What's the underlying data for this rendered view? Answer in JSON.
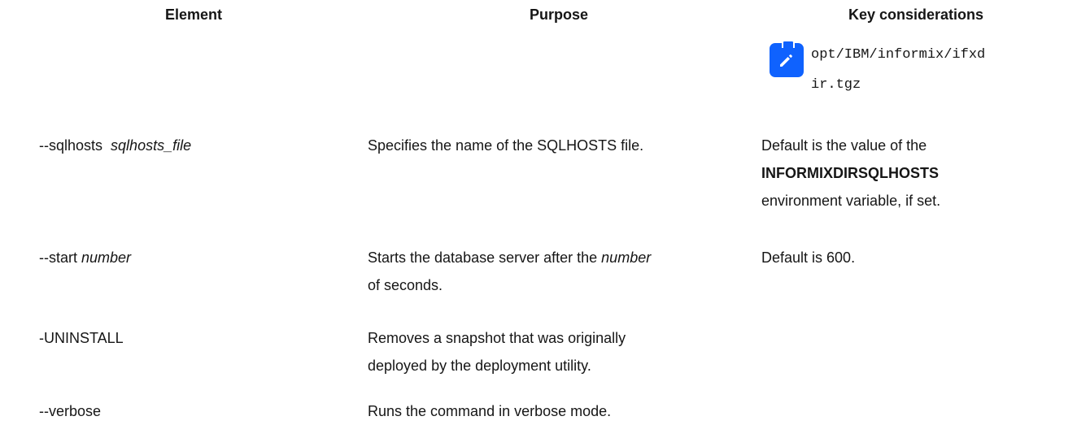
{
  "headers": {
    "element": "Element",
    "purpose": "Purpose",
    "key": "Key considerations"
  },
  "note": {
    "icon": "edit-note-icon",
    "path_line1": "opt/IBM/informix/ifxd",
    "path_line2": "ir.tgz"
  },
  "rows": [
    {
      "element_prefix": "--sqlhosts",
      "element_arg": "sqlhosts_file",
      "purpose_line1": "Specifies the name of the SQLHOSTS file.",
      "key_line1": "Default is the value of the",
      "key_bold": "INFORMIXDIRSQLHOSTS",
      "key_line3": "environment variable, if set."
    },
    {
      "element_prefix": "--start",
      "element_arg": "number",
      "purpose_line1_pre": "Starts the database server after the",
      "purpose_line1_arg": "number",
      "purpose_line2": "of seconds.",
      "key_line1": "Default is 600."
    },
    {
      "element_prefix": "-UNINSTALL",
      "purpose_line1": "Removes a snapshot that was originally",
      "purpose_line2": "deployed by the deployment utility."
    },
    {
      "element_prefix": "--verbose",
      "purpose_line1": "Runs the command in verbose mode."
    }
  ],
  "colors": {
    "text": "#161616",
    "icon_bg": "#0f62fe"
  }
}
